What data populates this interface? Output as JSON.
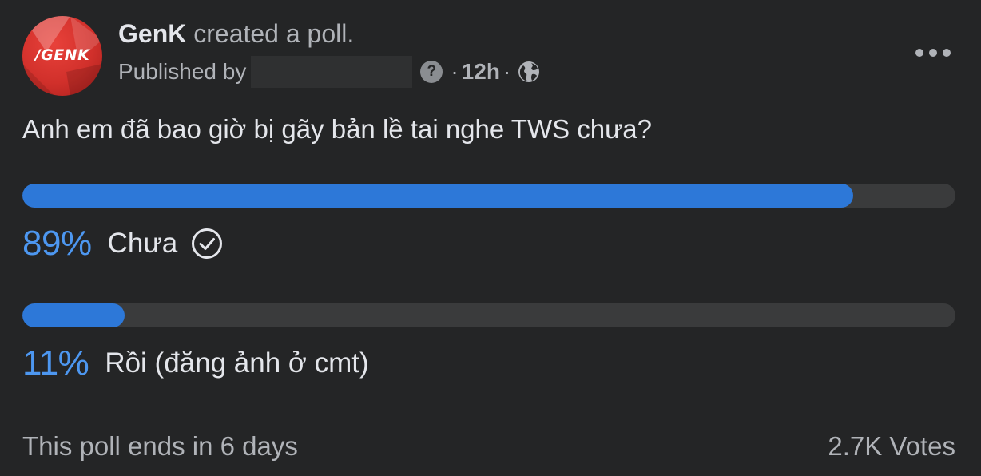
{
  "post": {
    "page_name": "GenK",
    "action_text": "created a poll.",
    "published_by_label": "Published by",
    "help_symbol": "?",
    "dot_separator": "·",
    "time": "12h",
    "privacy_icon": "globe-icon",
    "more_icon": "more-horizontal-icon",
    "avatar_logo": "/GENK"
  },
  "poll": {
    "question": "Anh em đã bao giờ bị gãy bản lề tai nghe TWS chưa?",
    "options": [
      {
        "percent_label": "89%",
        "fraction": 0.89,
        "text": "Chưa",
        "voted": true,
        "icon": "check-circle-icon"
      },
      {
        "percent_label": "11%",
        "fraction": 0.11,
        "text": "Rồi (đăng ảnh ở cmt)",
        "voted": false
      }
    ],
    "ends_text": "This poll ends in 6 days",
    "votes_text": "2.7K Votes"
  },
  "colors": {
    "background": "#242526",
    "bar_fill": "#2d78d8",
    "bar_track": "#3a3b3c",
    "percent_text": "#4d97f0",
    "secondary_text": "#b0b3b8",
    "primary_text": "#e4e6eb",
    "avatar_red": "#d1302b"
  }
}
